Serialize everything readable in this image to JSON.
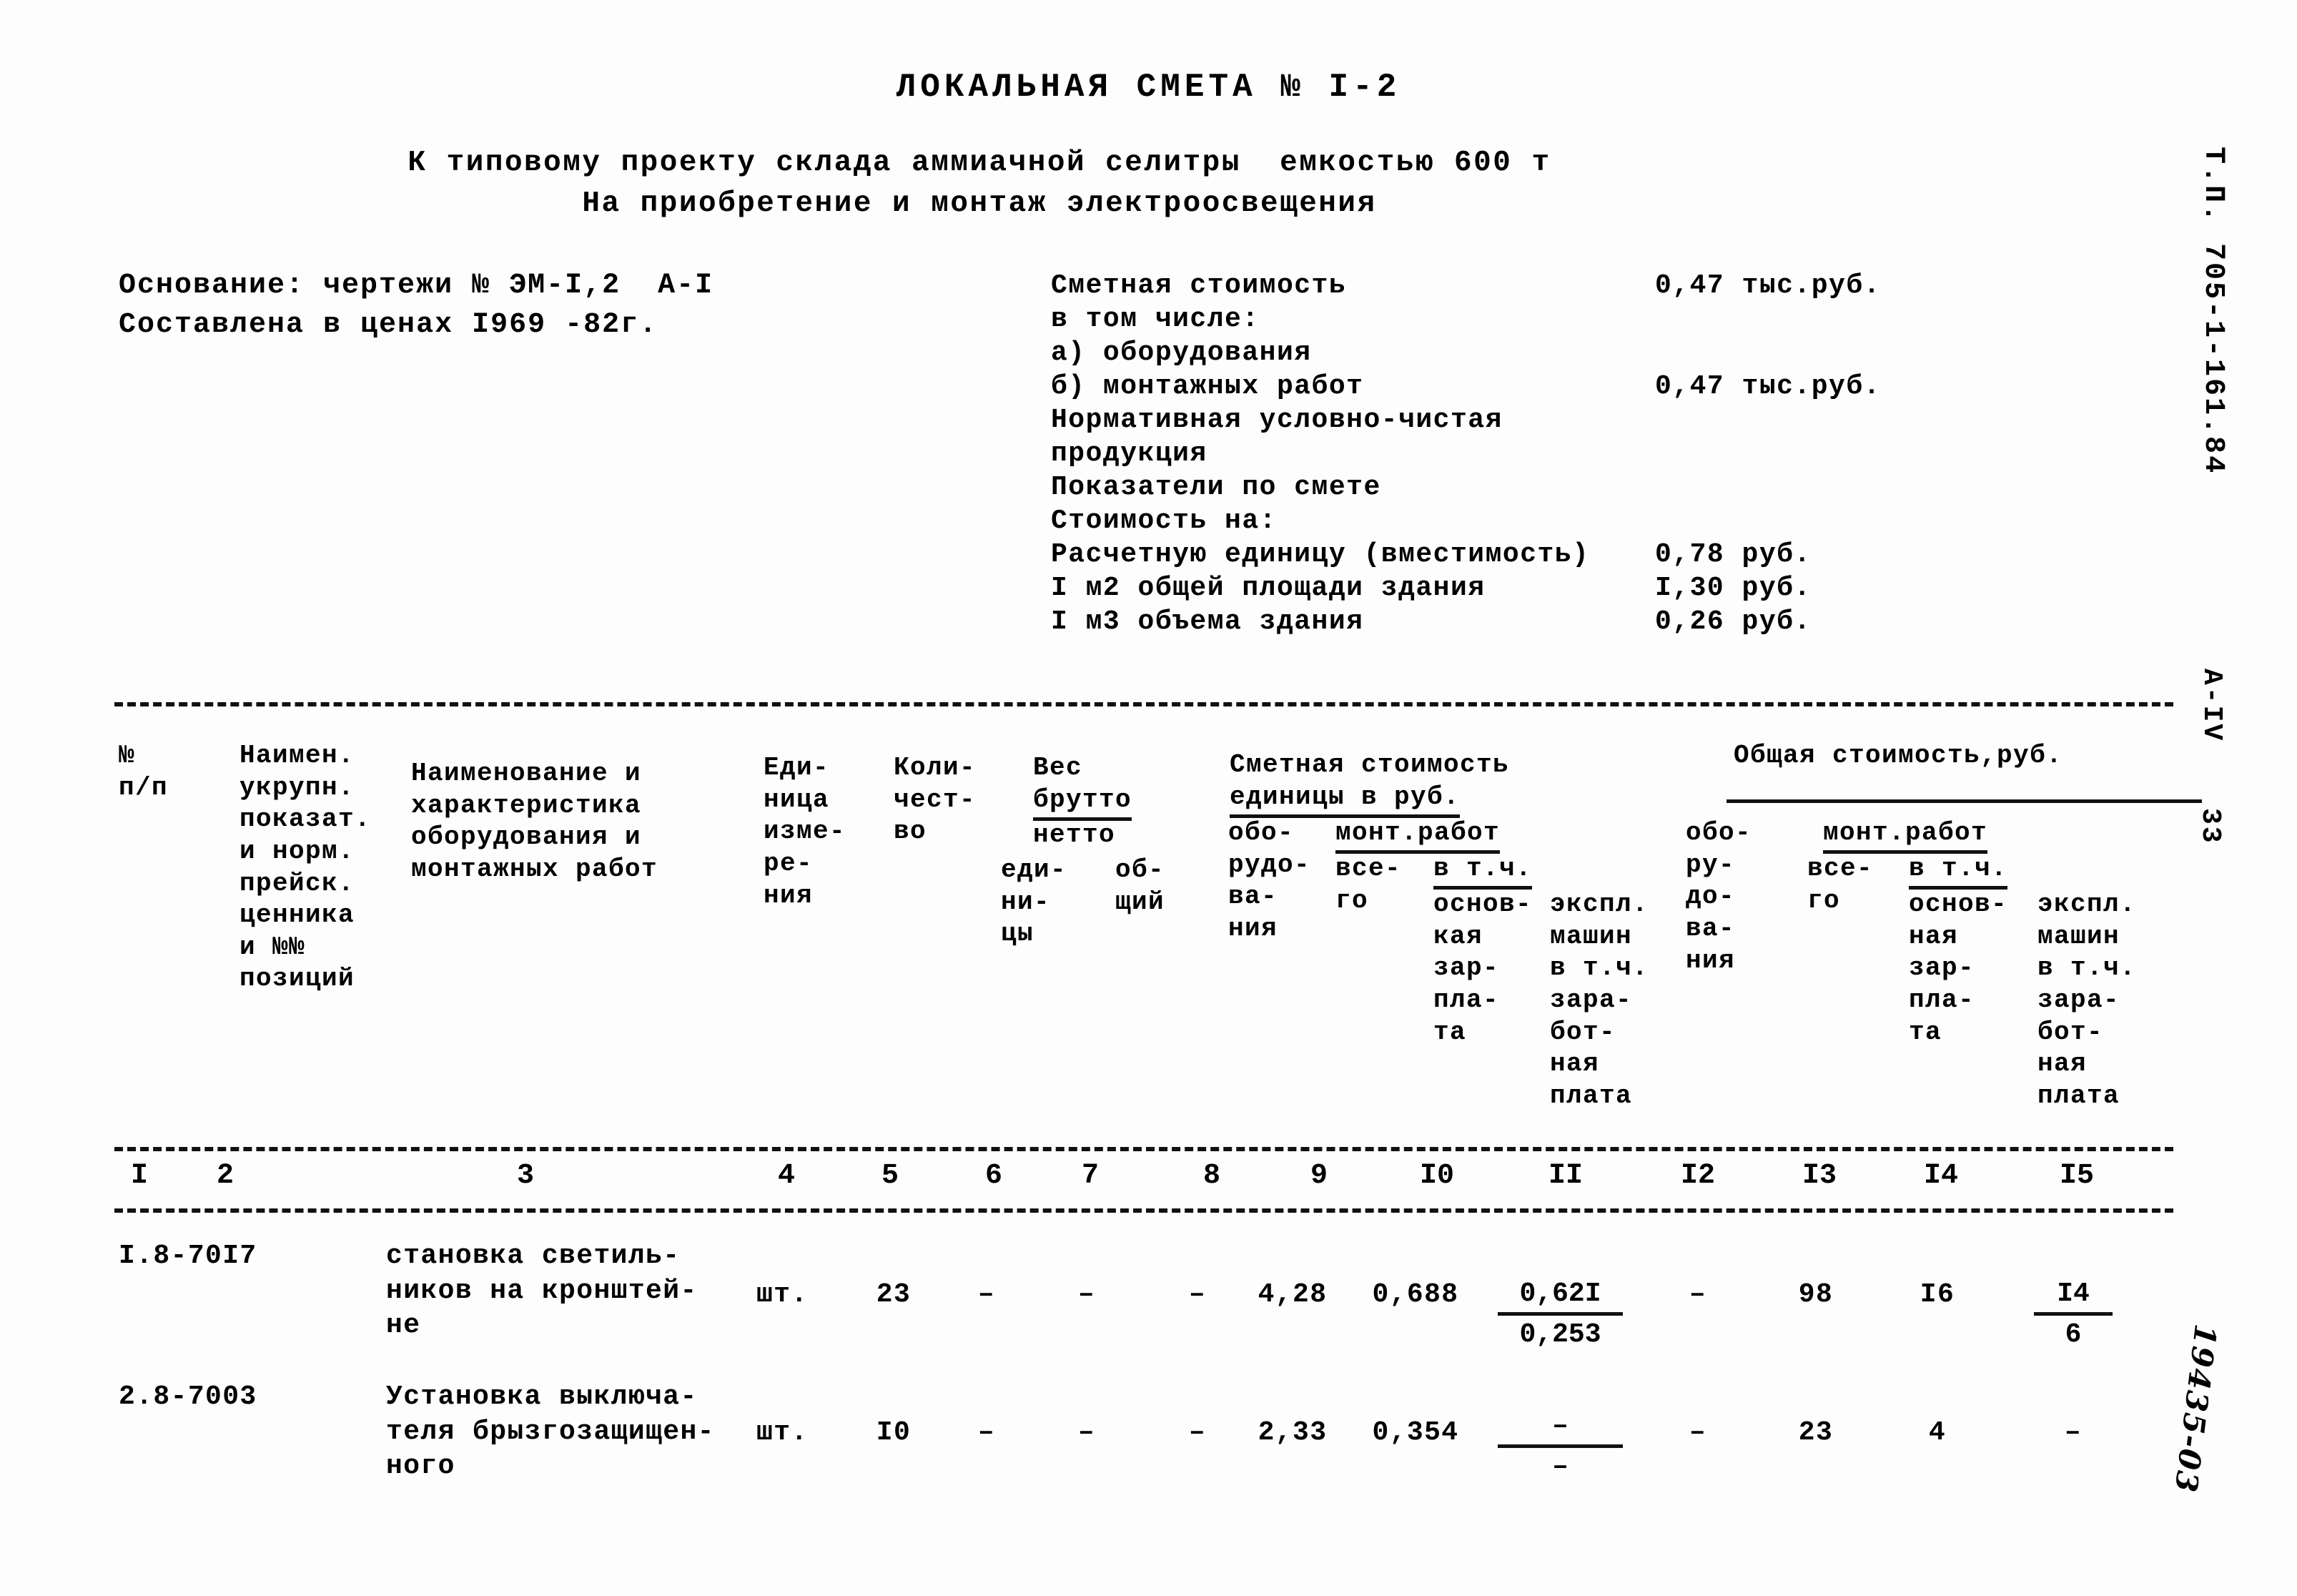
{
  "document": {
    "title": "ЛОКАЛЬНАЯ СМЕТА № I-2",
    "subtitle_line_1": "К типовому проекту склада аммиачной селитры  емкостью 600 т",
    "subtitle_line_2": "На приобретение и монтаж электроосвещения"
  },
  "basis": {
    "line_1": "Основание: чертежи № ЭМ-I,2  А-I",
    "line_2": "Составлена в ценах I969 -82г."
  },
  "summary": {
    "rows": [
      {
        "label": "Сметная стоимость",
        "value": "0,47 тыс.руб."
      },
      {
        "label": "в том числе:",
        "value": ""
      },
      {
        "label": "а) оборудования",
        "value": ""
      },
      {
        "label": "б) монтажных работ",
        "value": "0,47 тыс.руб."
      },
      {
        "label": "Нормативная условно-чистая",
        "value": ""
      },
      {
        "label": "продукция",
        "value": ""
      },
      {
        "label": "Показатели по смете",
        "value": ""
      },
      {
        "label": "Стоимость на:",
        "value": ""
      },
      {
        "label": "Расчетную единицу (вместимость)",
        "value": "0,78 руб."
      },
      {
        "label": "I м2 общей площади здания",
        "value": "I,30 руб."
      },
      {
        "label": "I м3 объема здания",
        "value": "0,26 руб."
      }
    ]
  },
  "table": {
    "headers": {
      "col1": "№\nп/п",
      "col2": "Наимен.\nукрупн.\nпоказат.\nи норм.\nпрейск.\nценника\nи №№\nпозиций",
      "col3": "Наименование и\nхарактеристика\nоборудования и\nмонтажных работ",
      "col4": "Еди-\nница\nизме-\nре-\nния",
      "col5": "Коли-\nчест-\nво",
      "col6_7_group": "Вес",
      "col6_7_brutto": "брутто",
      "col6_7_netto": "нетто",
      "col6": "еди-\nни-\nцы",
      "col7": "об-\nщий",
      "group_unit_cost_line1": "Сметная стоимость",
      "group_unit_cost_line2": "единицы в руб.",
      "col8": "обо-\nрудо-\nва-\nния",
      "col9_11_group": "монт.работ",
      "col9": "все-\nго",
      "col10_11_group": "в т.ч.",
      "col10": "основ-\nкая\nзар-\nпла-\nта",
      "col11": "экспл.\nмашин\nв т.ч.\nзара-\nбот-\nная\nплата",
      "group_total_cost": "Общая стоимость,руб.",
      "col12": "обо-\nру-\nдо-\nва-\nния",
      "col13_15_group": "монт.работ",
      "col13": "все-\nго",
      "col14_15_group": "в т.ч.",
      "col14": "основ-\nная\nзар-\nпла-\nта",
      "col15": "экспл.\nмашин\nв т.ч.\nзара-\nбот-\nная\nплата"
    },
    "column_numbers": [
      "I",
      "2",
      "3",
      "4",
      "5",
      "6",
      "7",
      "8",
      "9",
      "I0",
      "II",
      "I2",
      "I3",
      "I4",
      "I5"
    ],
    "rows": [
      {
        "c1": "I.8-70I7",
        "c3": "становка светиль-\nников на кронштей-\nне",
        "c4": "шт.",
        "c5": "23",
        "c6": "–",
        "c7": "–",
        "c8": "–",
        "c9": "4,28",
        "c10": "0,688",
        "c11_num": "0,62I",
        "c11_den": "0,253",
        "c12": "–",
        "c13": "98",
        "c14": "I6",
        "c15_num": "I4",
        "c15_den": "6"
      },
      {
        "c1": "2.8-7003",
        "c3": "Установка выключа-\nтеля брызгозащищен-\nного",
        "c4": "шт.",
        "c5": "I0",
        "c6": "–",
        "c7": "–",
        "c8": "–",
        "c9": "2,33",
        "c10": "0,354",
        "c11_num": "–",
        "c11_den": "–",
        "c12": "–",
        "c13": "23",
        "c14": "4",
        "c15_num": "–",
        "c15_den": ""
      }
    ]
  },
  "margin_stamps": {
    "project_code": "Т.П. 705-1-161.84",
    "series": "А-IV",
    "page_number": "33",
    "handwritten_number": "19435-03"
  }
}
